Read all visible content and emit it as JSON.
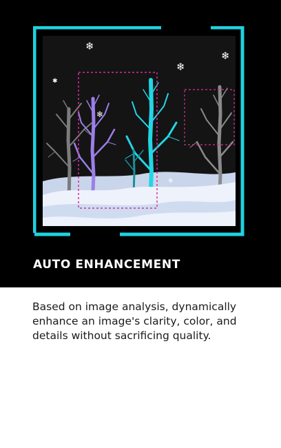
{
  "feature": {
    "title": "AUTO ENHANCEMENT",
    "description": "Based on image analysis, dynamically enhance an image's clarity, color, and details without sacrificing quality."
  },
  "illustration": {
    "icon": "winter-forest-illustration",
    "colors": {
      "frame": "#1fd2e0",
      "night_sky": "#141414",
      "highlight_tree": "#9b7fe8",
      "cyan_tree": "#22d6e6",
      "selection_box": "#d62f9a",
      "snow": "#eef2fb"
    }
  }
}
